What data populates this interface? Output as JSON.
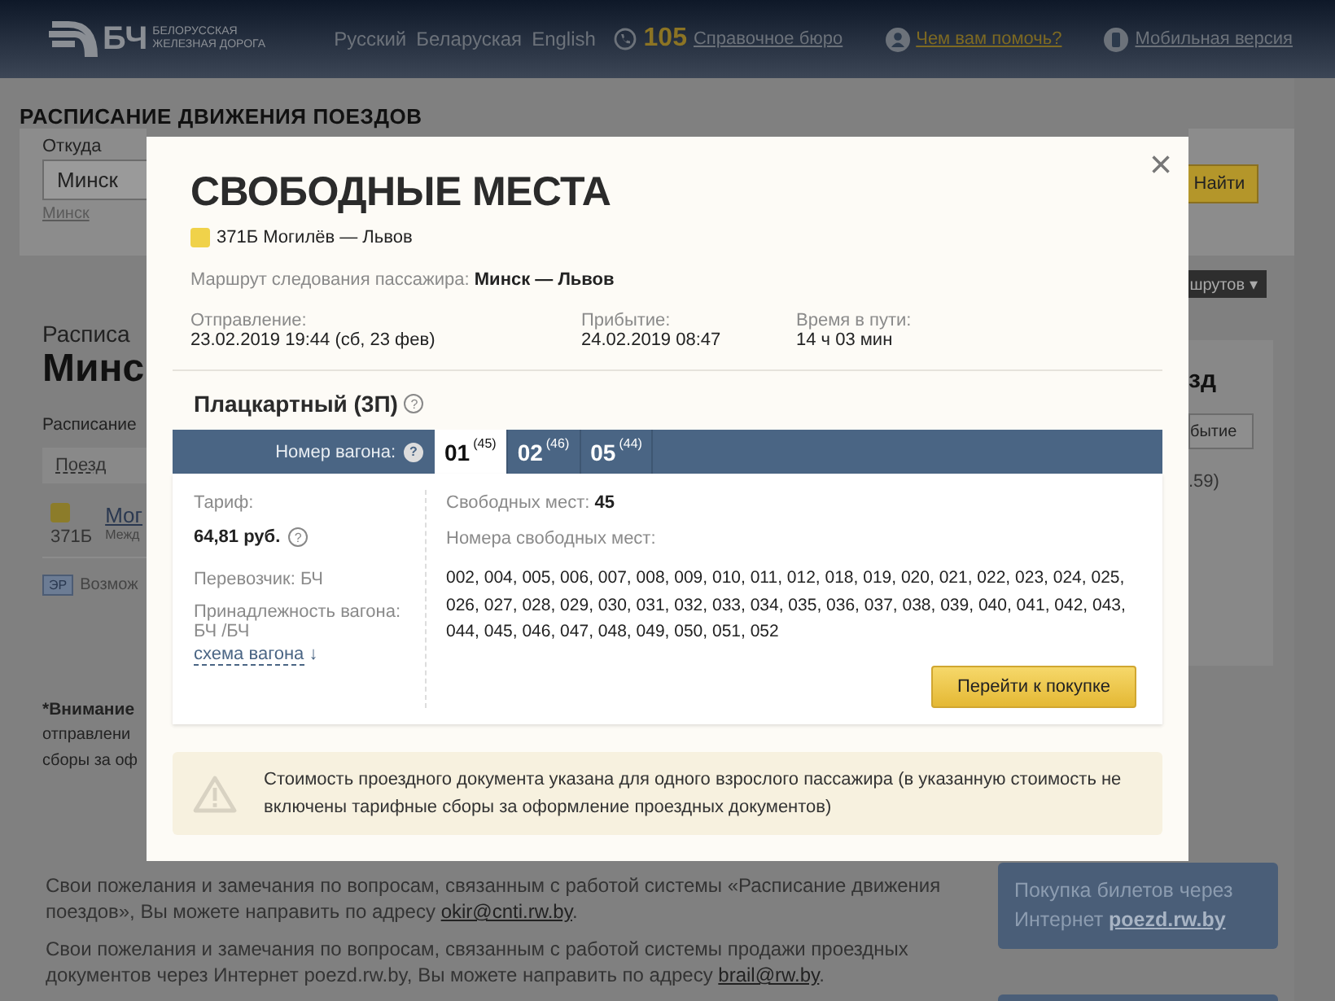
{
  "header": {
    "logo_text": "БЧ",
    "logo_subtitle": "БЕЛОРУССКАЯ ЖЕЛЕЗНАЯ ДОРОГА",
    "languages": [
      "Русский",
      "Беларуская",
      "English"
    ],
    "phone": "105",
    "help_desk": "Справочное бюро",
    "help_link": "Чем вам помочь?",
    "mobile_link": "Мобильная версия"
  },
  "page_title": "РАСПИСАНИЕ ДВИЖЕНИЯ ПОЕЗДОВ",
  "search": {
    "from_label": "Откуда",
    "from_value": "Минск",
    "from_hint": "Минск",
    "find_button": "Найти",
    "routes_button": "шрутов",
    "routes_caret": "▾"
  },
  "schedule": {
    "heading_small": "Расписа",
    "heading_big": "Минс",
    "subheading": "Расписание",
    "column_1": "Поезд",
    "rows": [
      {
        "name": "Мог",
        "number": "371Б",
        "type": "Межд"
      }
    ],
    "er_badge": "ЭР",
    "note": "Возмож"
  },
  "side_panel": {
    "title": "зд",
    "button": "бытие",
    "text": ".59)"
  },
  "notice": {
    "bold": "*Внимание",
    "lines": [
      "отправлени",
      "сборы за оф"
    ]
  },
  "feedback": [
    {
      "text": "Свои пожелания и замечания по вопросам, связанным с работой системы «Расписание движения поездов», Вы можете направить по адресу ",
      "email": "okir@cnti.rw.by",
      "end": "."
    },
    {
      "text": "Свои пожелания и замечания по вопросам, связанным с работой системы продажи проездных документов через Интернет poezd.rw.by, Вы можете направить по адресу ",
      "email": "brail@rw.by",
      "end": "."
    }
  ],
  "promo": {
    "text": "Покупка билетов через Интернет",
    "link": "poezd.rw.by"
  },
  "modal": {
    "title": "СВОБОДНЫЕ МЕСТА",
    "close": "×",
    "help_mark": "?",
    "train": "371Б Могилёв — Львов",
    "route_label": "Маршрут следования пассажира:",
    "route": "Минск — Львов",
    "trip": [
      {
        "label": "Отправление:",
        "value": "23.02.2019 19:44 (сб, 23 фев)"
      },
      {
        "label": "Прибытие:",
        "value": "24.02.2019 08:47"
      },
      {
        "label": "Время в пути:",
        "value": "14 ч 03 мин"
      }
    ],
    "car_class": "Плацкартный (3П)",
    "car_number_label": "Номер вагона:",
    "cars": [
      {
        "number": "01",
        "seats": "(45)",
        "selected": true
      },
      {
        "number": "02",
        "seats": "(46)",
        "selected": false
      },
      {
        "number": "05",
        "seats": "(44)",
        "selected": false
      }
    ],
    "tariff_label": "Тариф:",
    "tariff": "64,81 руб.",
    "carrier": "Перевозчик: БЧ",
    "ownership_label": "Принадлежность вагона:",
    "ownership": "БЧ /БЧ",
    "scheme_link": "схема вагона",
    "scheme_arrow": "↓",
    "free_label": "Свободных мест:",
    "free_count": "45",
    "seats_label": "Номера свободных мест:",
    "seats": "002, 004, 005, 006, 007, 008, 009, 010, 011, 012, 018, 019, 020, 021, 022, 023, 024, 025, 026, 027, 028, 029, 030, 031, 032, 033, 034, 035, 036, 037, 038, 039, 040, 041, 042, 043, 044, 045, 046, 047, 048, 049, 050, 051, 052",
    "buy_button": "Перейти к покупке",
    "warning": "Стоимость проездного документа указана для одного взрослого пассажира (в указанную стоимость не включены тарифные сборы за оформление проездных документов)"
  }
}
